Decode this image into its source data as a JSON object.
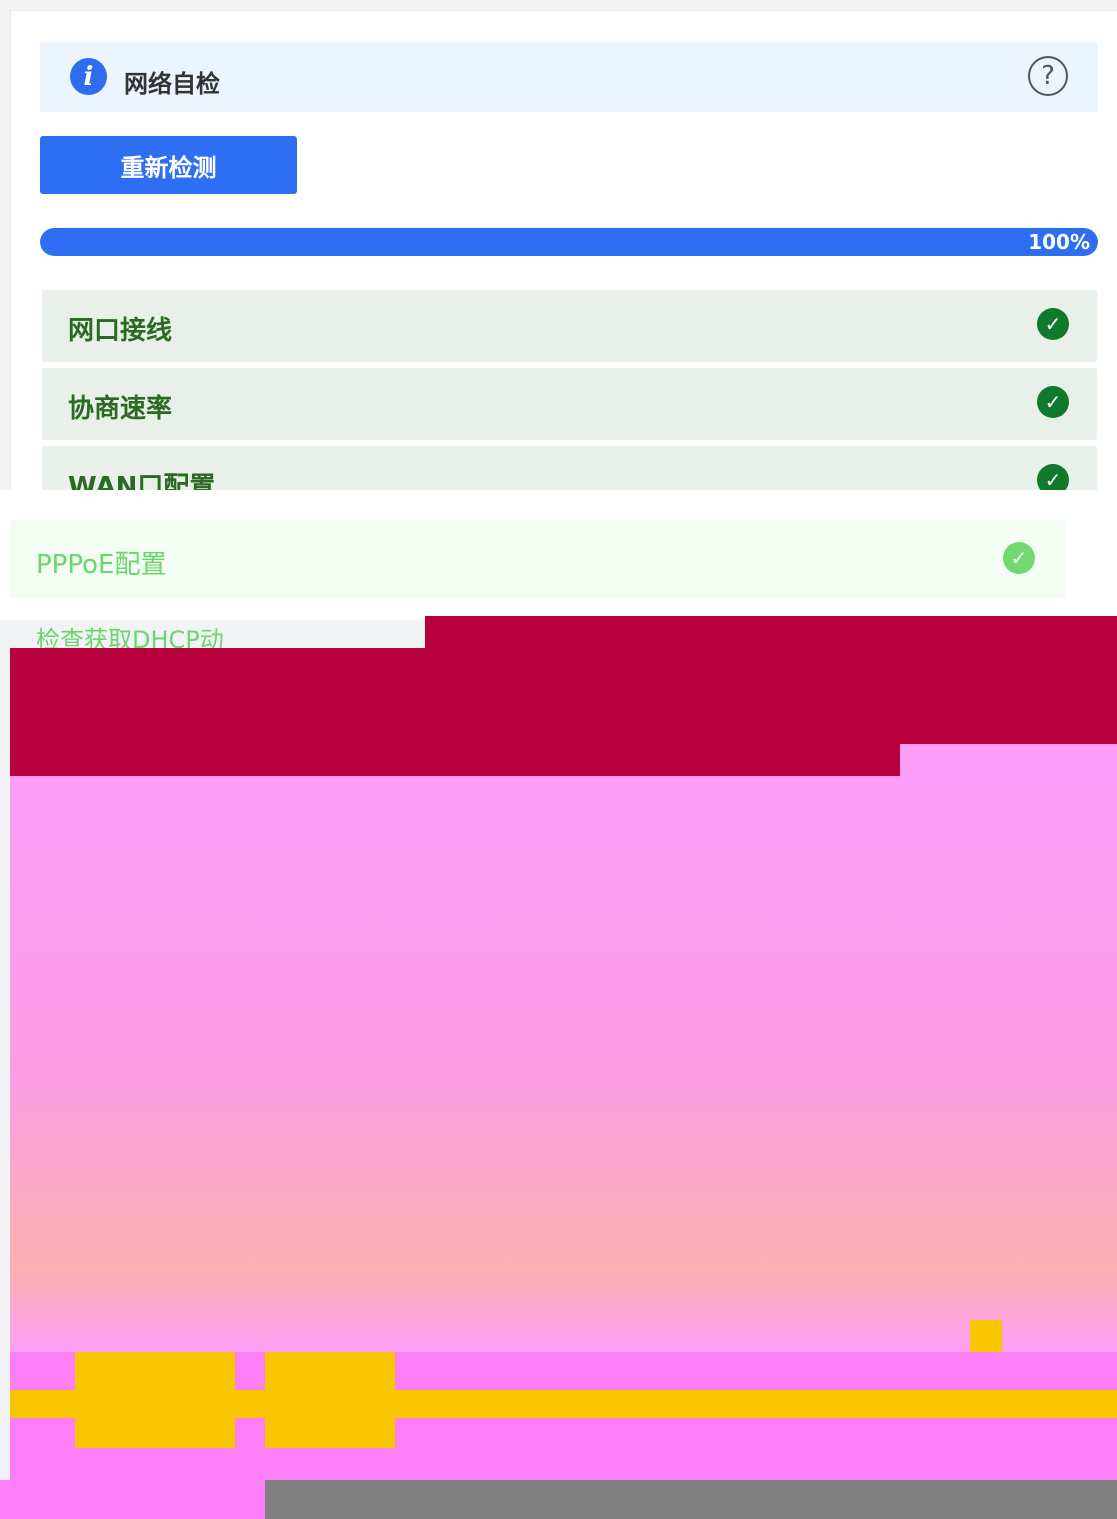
{
  "header": {
    "title": "网络自检",
    "info_icon": "info-icon",
    "help_icon": "question-circle-icon"
  },
  "toolbar": {
    "recheck_label": "重新检测"
  },
  "progress": {
    "value_percent": 100,
    "label": "100%"
  },
  "checks": [
    {
      "label": "网口接线",
      "status": "ok"
    },
    {
      "label": "协商速率",
      "status": "ok"
    },
    {
      "label": "WAN口配置",
      "status": "ok"
    }
  ],
  "faded": {
    "pppoe_label": "PPPoE配置",
    "dhcp_label": "检查获取DHCP动"
  },
  "colors": {
    "accent": "#2e6ef2",
    "ok": "#0f7a2c",
    "row_bg": "#e9efe9"
  }
}
